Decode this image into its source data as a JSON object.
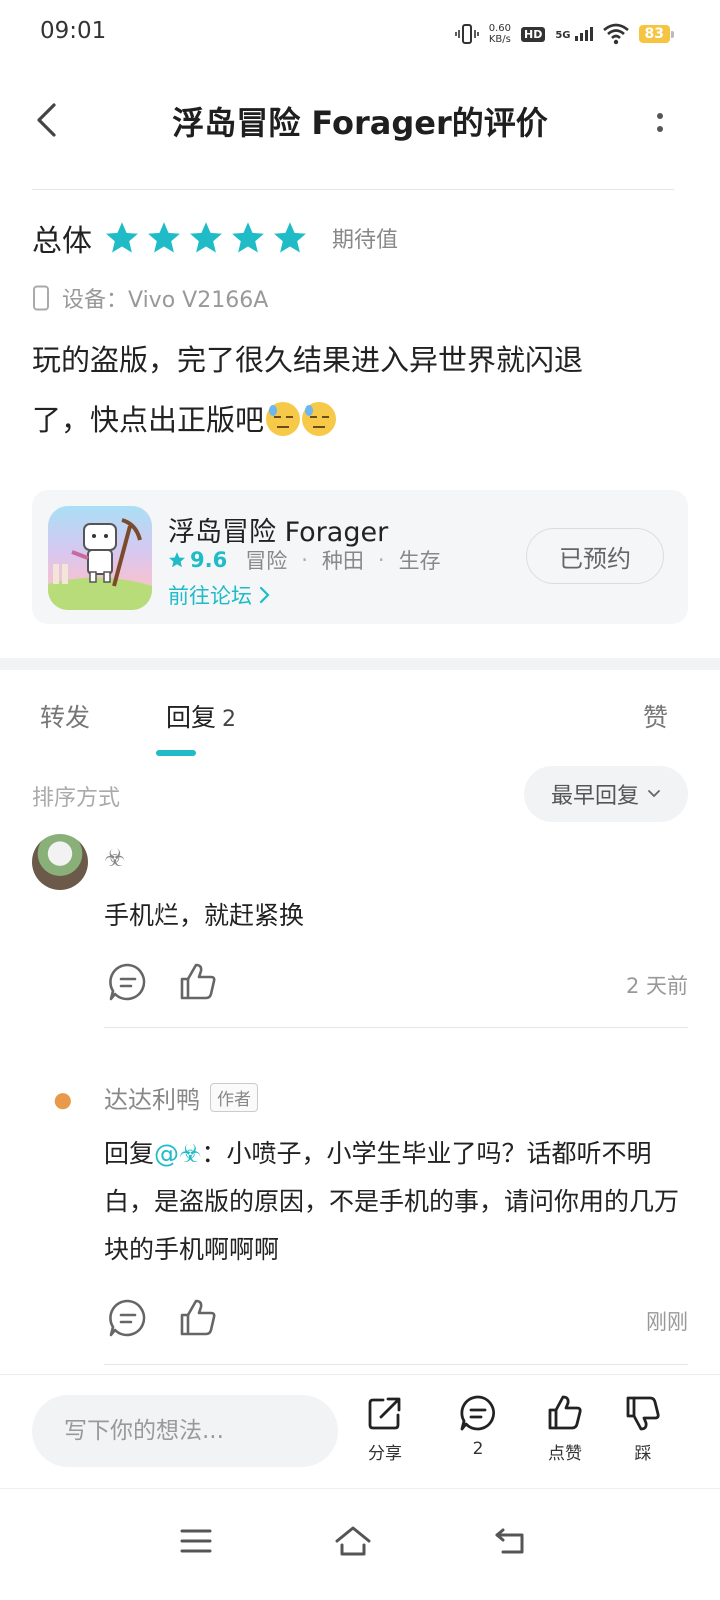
{
  "status_bar": {
    "time": "09:01",
    "net_speed_value": "0.60",
    "net_speed_unit": "KB/s",
    "hd": "HD",
    "signal": "5G",
    "battery": "83"
  },
  "header": {
    "title": "浮岛冒险 Forager的评价"
  },
  "rating": {
    "overall_label": "总体",
    "stars": 5,
    "expect_label": "期待值"
  },
  "device": {
    "label": "设备：Vivo V2166A"
  },
  "review": {
    "line1": "玩的盗版，完了很久结果进入异世界就闪退",
    "line2": "了，快点出正版吧"
  },
  "game_card": {
    "name": "浮岛冒险 Forager",
    "score": "9.6",
    "tags": [
      "冒险",
      "种田",
      "生存"
    ],
    "forum_link": "前往论坛",
    "reserve_button": "已预约"
  },
  "tabs": {
    "forward": "转发",
    "reply": "回复",
    "reply_count": "2",
    "like": "赞"
  },
  "sort": {
    "label": "排序方式",
    "selected": "最早回复"
  },
  "comments": [
    {
      "name": "☣",
      "text": "手机烂，就赶紧换",
      "time": "2 天前"
    },
    {
      "name": "达达利鸭",
      "author_tag": "作者",
      "reply_prefix": "回复",
      "mention": "@☣",
      "text": "：小喷子，小学生毕业了吗？话都听不明白，是盗版的原因，不是手机的事，请问你用的几万块的手机啊啊啊",
      "time": "刚刚"
    }
  ],
  "bottom_bar": {
    "placeholder": "写下你的想法...",
    "share": "分享",
    "comment_count": "2",
    "like": "点赞",
    "dislike": "踩"
  },
  "colors": {
    "accent": "#1fbcc8",
    "battery": "#f5c542"
  }
}
